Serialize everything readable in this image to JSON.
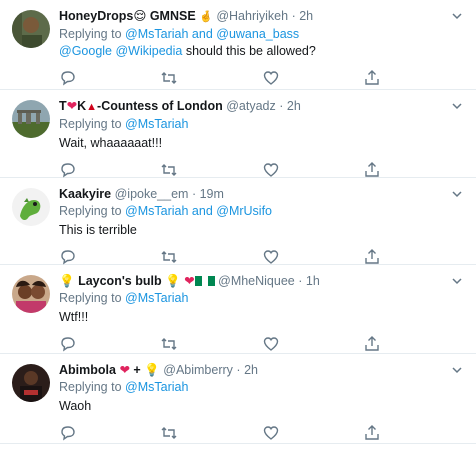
{
  "tweets": [
    {
      "name": "HoneyDrops😌 GMNSE",
      "name_suffix": "🤞",
      "handle": "@Hahriyikeh",
      "time": "2h",
      "reply_prefix": "Replying to",
      "mention1": "@MsTariah",
      "reply_and": "and",
      "mention2": "@uwana_bass",
      "text_mention1": "@Google",
      "text_mention2": "@Wikipedia",
      "text": "should this be allowed?"
    },
    {
      "name_t": "T",
      "name_k": "K",
      "name_rest": "-Countess of London",
      "handle": "@atyadz",
      "time": "2h",
      "reply_prefix": "Replying to",
      "mention1": "@MsTariah",
      "text": "Wait, whaaaaaat!!!"
    },
    {
      "name": "Kaakyire",
      "handle": "@ipoke__em",
      "time": "19m",
      "reply_prefix": "Replying to",
      "mention1": "@MsTariah",
      "reply_and": "and",
      "mention2": "@MrUsifo",
      "text": "This is terrible"
    },
    {
      "name": "Laycon's bulb",
      "handle": "@MheNiquee",
      "time": "1h",
      "reply_prefix": "Replying to",
      "mention1": "@MsTariah",
      "text": "Wtf!!!"
    },
    {
      "name": "Abimbola",
      "name_plus": "+",
      "handle": "@Abimberry",
      "time": "2h",
      "reply_prefix": "Replying to",
      "mention1": "@MsTariah",
      "text": "Waoh"
    }
  ],
  "separator": "·",
  "icons": {
    "heart": "heart-emoji",
    "bulb": "lightbulb-emoji",
    "flag": "nigeria-flag-emoji",
    "santa": "santa-hat-emoji"
  },
  "colors": {
    "mention": "#1b95e0",
    "secondary_text": "#657786",
    "divider": "#e6ecf0",
    "heart": "#e0245e"
  }
}
